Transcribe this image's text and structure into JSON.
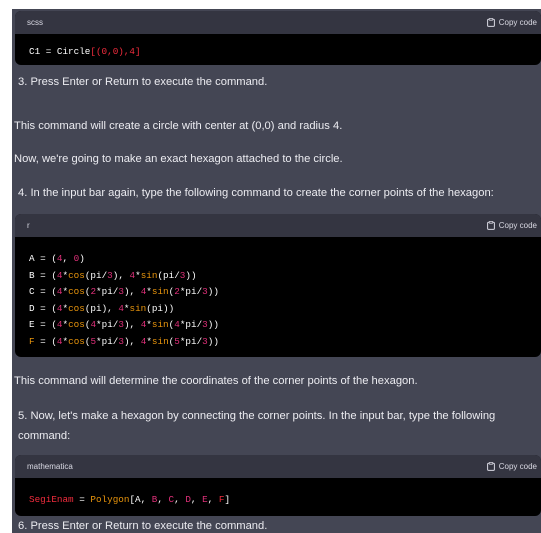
{
  "copy_label": "Copy code",
  "blocks": {
    "b1": {
      "lang": "scss",
      "lines": [
        [
          {
            "t": "C1 = Circle",
            "c": "p"
          },
          {
            "t": "[(0,0),4]",
            "c": "f"
          }
        ]
      ]
    },
    "b2": {
      "lang": "r",
      "lines": [
        [
          {
            "t": "A = (",
            "c": "p"
          },
          {
            "t": "4",
            "c": "n"
          },
          {
            "t": ", ",
            "c": "p"
          },
          {
            "t": "0",
            "c": "n"
          },
          {
            "t": ")",
            "c": "p"
          }
        ],
        [
          {
            "t": "B = (",
            "c": "p"
          },
          {
            "t": "4",
            "c": "n"
          },
          {
            "t": "*",
            "c": "p"
          },
          {
            "t": "cos",
            "c": "fn"
          },
          {
            "t": "(pi/",
            "c": "p"
          },
          {
            "t": "3",
            "c": "n"
          },
          {
            "t": "), ",
            "c": "p"
          },
          {
            "t": "4",
            "c": "n"
          },
          {
            "t": "*",
            "c": "p"
          },
          {
            "t": "sin",
            "c": "fn"
          },
          {
            "t": "(pi/",
            "c": "p"
          },
          {
            "t": "3",
            "c": "n"
          },
          {
            "t": "))",
            "c": "p"
          }
        ],
        [
          {
            "t": "C = (",
            "c": "p"
          },
          {
            "t": "4",
            "c": "n"
          },
          {
            "t": "*",
            "c": "p"
          },
          {
            "t": "cos",
            "c": "fn"
          },
          {
            "t": "(",
            "c": "p"
          },
          {
            "t": "2",
            "c": "n"
          },
          {
            "t": "*pi/",
            "c": "p"
          },
          {
            "t": "3",
            "c": "n"
          },
          {
            "t": "), ",
            "c": "p"
          },
          {
            "t": "4",
            "c": "n"
          },
          {
            "t": "*",
            "c": "p"
          },
          {
            "t": "sin",
            "c": "fn"
          },
          {
            "t": "(",
            "c": "p"
          },
          {
            "t": "2",
            "c": "n"
          },
          {
            "t": "*pi/",
            "c": "p"
          },
          {
            "t": "3",
            "c": "n"
          },
          {
            "t": "))",
            "c": "p"
          }
        ],
        [
          {
            "t": "D = (",
            "c": "p"
          },
          {
            "t": "4",
            "c": "n"
          },
          {
            "t": "*",
            "c": "p"
          },
          {
            "t": "cos",
            "c": "fn"
          },
          {
            "t": "(pi), ",
            "c": "p"
          },
          {
            "t": "4",
            "c": "n"
          },
          {
            "t": "*",
            "c": "p"
          },
          {
            "t": "sin",
            "c": "fn"
          },
          {
            "t": "(pi))",
            "c": "p"
          }
        ],
        [
          {
            "t": "E = (",
            "c": "p"
          },
          {
            "t": "4",
            "c": "n"
          },
          {
            "t": "*",
            "c": "p"
          },
          {
            "t": "cos",
            "c": "fn"
          },
          {
            "t": "(",
            "c": "p"
          },
          {
            "t": "4",
            "c": "n"
          },
          {
            "t": "*pi/",
            "c": "p"
          },
          {
            "t": "3",
            "c": "n"
          },
          {
            "t": "), ",
            "c": "p"
          },
          {
            "t": "4",
            "c": "n"
          },
          {
            "t": "*",
            "c": "p"
          },
          {
            "t": "sin",
            "c": "fn"
          },
          {
            "t": "(",
            "c": "p"
          },
          {
            "t": "4",
            "c": "n"
          },
          {
            "t": "*pi/",
            "c": "p"
          },
          {
            "t": "3",
            "c": "n"
          },
          {
            "t": "))",
            "c": "p"
          }
        ],
        [
          {
            "t": "F",
            "c": "fn"
          },
          {
            "t": " = (",
            "c": "p"
          },
          {
            "t": "4",
            "c": "n"
          },
          {
            "t": "*",
            "c": "p"
          },
          {
            "t": "cos",
            "c": "fn"
          },
          {
            "t": "(",
            "c": "p"
          },
          {
            "t": "5",
            "c": "n"
          },
          {
            "t": "*pi/",
            "c": "p"
          },
          {
            "t": "3",
            "c": "n"
          },
          {
            "t": "), ",
            "c": "p"
          },
          {
            "t": "4",
            "c": "n"
          },
          {
            "t": "*",
            "c": "p"
          },
          {
            "t": "sin",
            "c": "fn"
          },
          {
            "t": "(",
            "c": "p"
          },
          {
            "t": "5",
            "c": "n"
          },
          {
            "t": "*pi/",
            "c": "p"
          },
          {
            "t": "3",
            "c": "n"
          },
          {
            "t": "))",
            "c": "p"
          }
        ]
      ]
    },
    "b3": {
      "lang": "mathematica",
      "lines": [
        [
          {
            "t": "SegiEnam",
            "c": "f"
          },
          {
            "t": " = ",
            "c": "p"
          },
          {
            "t": "Polygon",
            "c": "fn"
          },
          {
            "t": "[A, ",
            "c": "p"
          },
          {
            "t": "B",
            "c": "n"
          },
          {
            "t": ", ",
            "c": "p"
          },
          {
            "t": "C",
            "c": "n"
          },
          {
            "t": ", ",
            "c": "p"
          },
          {
            "t": "D",
            "c": "n"
          },
          {
            "t": ", ",
            "c": "p"
          },
          {
            "t": "E",
            "c": "n"
          },
          {
            "t": ", ",
            "c": "p"
          },
          {
            "t": "F",
            "c": "f"
          },
          {
            "t": "]",
            "c": "p"
          }
        ]
      ]
    }
  },
  "text": {
    "step3": "3. Press Enter or Return to execute the command.",
    "circle_note": "This command will create a circle with center at (0,0) and radius 4.",
    "hexagon_intro": "Now, we're going to make an exact hexagon attached to the circle.",
    "step4": "4. In the input bar again, type the following command to create the corner points of the hexagon:",
    "coords_note": "This command will determine the coordinates of the corner points of the hexagon.",
    "step5": "5. Now, let's make a hexagon by connecting the corner points. In the input bar, type the following command:",
    "step6": "6. Press Enter or Return to execute the command."
  }
}
